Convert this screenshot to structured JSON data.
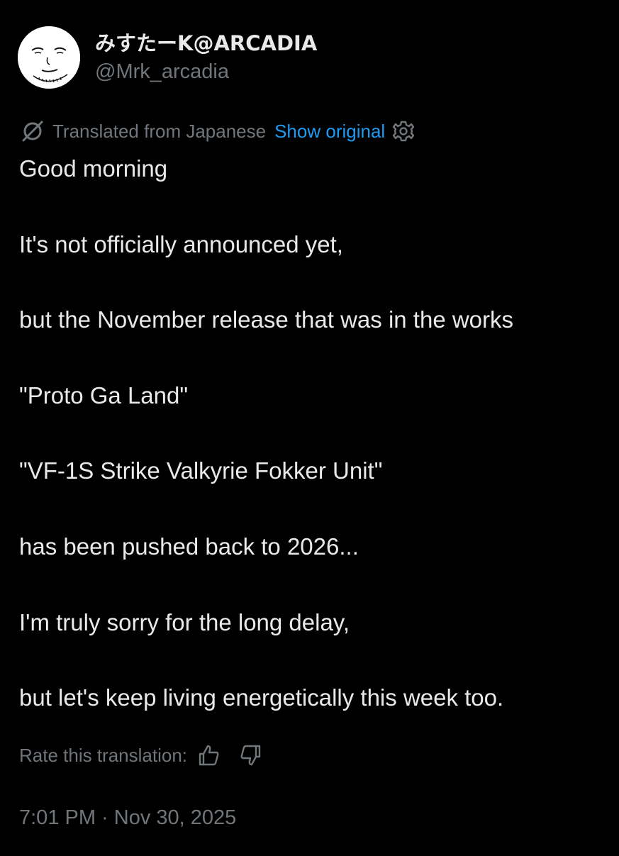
{
  "author": {
    "display_name": "みすたーK@ARCADIA",
    "handle": "@Mrk_arcadia",
    "avatar_icon": "face-sketch-avatar"
  },
  "translation": {
    "icon": "no-translate-icon",
    "label": "Translated from Japanese",
    "show_original": "Show original",
    "settings_icon": "gear-icon",
    "link_color": "#1d9bf0"
  },
  "tweet": {
    "lines": [
      "Good morning",
      "It's not officially announced yet,",
      "but the November release that was in the works",
      "\"Proto Ga Land\"",
      "\"VF-1S Strike Valkyrie Fokker Unit\"",
      "has been pushed back to 2026...",
      "I'm truly sorry for the long delay,",
      "but let's keep living energetically this week too."
    ]
  },
  "rating": {
    "label": "Rate this translation:",
    "up_icon": "thumbs-up-icon",
    "down_icon": "thumbs-down-icon"
  },
  "meta": {
    "timestamp": "7:01 PM · Nov 30, 2025"
  },
  "colors": {
    "background": "#000000",
    "primary_text": "#e7e9ea",
    "secondary_text": "#71767b"
  }
}
